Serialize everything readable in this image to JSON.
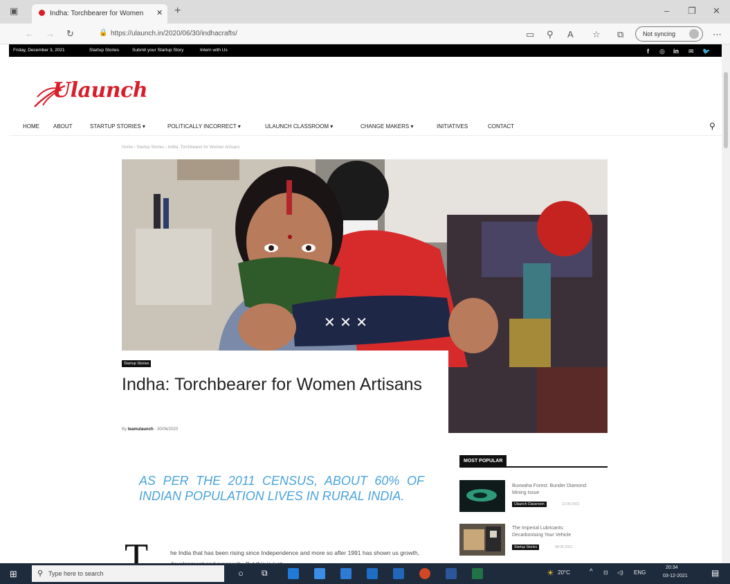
{
  "browser": {
    "tab_title": "Indha: Torchbearer for Women",
    "url": "https://ulaunch.in/2020/06/30/indhacrafts/",
    "sync_label": "Not syncing"
  },
  "topbar": {
    "date": "Friday, December 3, 2021",
    "links": [
      "Startup Stories",
      "Submit your Startup Story",
      "Intern with Us"
    ]
  },
  "logo": "Ulaunch",
  "nav": [
    "HOME",
    "ABOUT",
    "STARTUP STORIES ▾",
    "POLITICALLY INCORRECT ▾",
    "ULAUNCH CLASSROOM ▾",
    "CHANGE MAKERS ▾",
    "INITIATIVES",
    "CONTACT"
  ],
  "breadcrumb": "Home › Startup Stories › Indha: Torchbearer for Women Artisans",
  "article": {
    "category": "Startup Stories",
    "title": "Indha: Torchbearer for Women Artisans",
    "byline_prefix": "By",
    "author": "teamulaunch",
    "date": "30/06/2020",
    "quote": "AS PER THE 2011 CENSUS, ABOUT 60% OF INDIAN POPULATION LIVES IN RURAL INDIA.",
    "dropcap": "T",
    "paragraph": "he India that has been rising since Independence and more so after 1991 has shown us growth, development and prosperity. But this is just"
  },
  "sidebar": {
    "title": "MOST POPULAR",
    "items": [
      {
        "title": "Buxwaha Forest: Bunder Diamond Mining Issue",
        "category": "Ulaunch Classroom",
        "date": "12-06-2021"
      },
      {
        "title": "The Imperial Lubricants: Decarbonising Your Vehicle",
        "category": "Startup Stories",
        "date": "08-06-2021"
      }
    ]
  },
  "taskbar": {
    "search_placeholder": "Type here to search",
    "weather": "20°C",
    "language": "ENG",
    "time": "20:34",
    "date": "03-12-2021"
  },
  "colors": {
    "brand_red": "#d81e2a",
    "quote_blue": "#4aa3dc",
    "taskbar": "#1e2b3d"
  }
}
